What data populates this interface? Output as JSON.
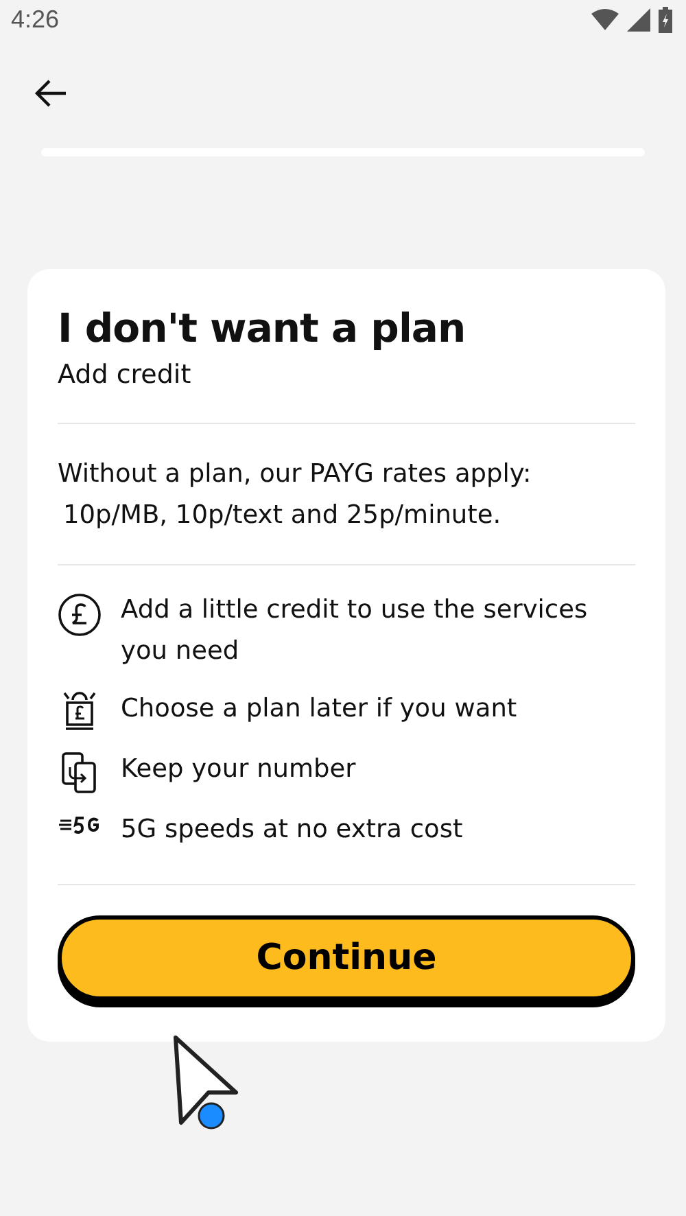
{
  "status_bar": {
    "time": "4:26"
  },
  "card": {
    "title": "I don't want a plan",
    "subtitle": "Add credit",
    "rates_lines": [
      "Without a plan, our PAYG rates apply:",
      "10p/MB, 10p/text and 25p/minute."
    ],
    "features": [
      {
        "kind": "pound",
        "text": "Add a little credit to use the services you need"
      },
      {
        "kind": "shop",
        "text": "Choose a plan later if you want"
      },
      {
        "kind": "phones",
        "text": "Keep your number"
      },
      {
        "kind": "fiveg",
        "text": "5G speeds at no extra cost"
      }
    ],
    "button": "Continue"
  }
}
